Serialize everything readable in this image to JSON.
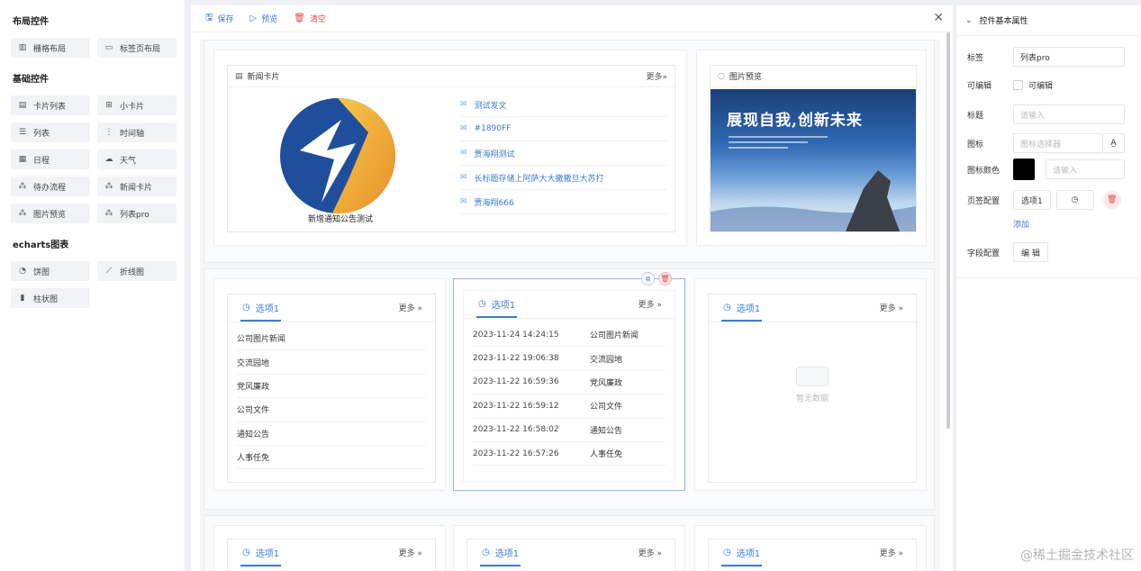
{
  "left": {
    "sections": [
      {
        "title": "布局控件",
        "items": [
          {
            "label": "栅格布局",
            "icon": "grid-icon"
          },
          {
            "label": "标签页布局",
            "icon": "folder-icon"
          }
        ]
      },
      {
        "title": "基础控件",
        "items": [
          {
            "label": "卡片列表",
            "icon": "card-list-icon"
          },
          {
            "label": "小卡片",
            "icon": "small-card-icon"
          },
          {
            "label": "列表",
            "icon": "list-icon"
          },
          {
            "label": "时间轴",
            "icon": "timeline-icon"
          },
          {
            "label": "日程",
            "icon": "calendar-icon"
          },
          {
            "label": "天气",
            "icon": "cloud-icon"
          },
          {
            "label": "待办流程",
            "icon": "flow-icon"
          },
          {
            "label": "新闻卡片",
            "icon": "flow-icon"
          },
          {
            "label": "图片预览",
            "icon": "flow-icon"
          },
          {
            "label": "列表pro",
            "icon": "flow-icon"
          }
        ]
      },
      {
        "title": "echarts图表",
        "items": [
          {
            "label": "饼图",
            "icon": "pie-icon"
          },
          {
            "label": "折线图",
            "icon": "line-chart-icon"
          },
          {
            "label": "柱状图",
            "icon": "bar-chart-icon"
          }
        ]
      }
    ]
  },
  "toolbar": {
    "save": "保存",
    "preview": "预览",
    "clear": "清空"
  },
  "news_card": {
    "title": "新闻卡片",
    "more": "更多»",
    "caption": "新增通知公告测试",
    "items": [
      "测试发文",
      "#1890FF",
      "贾海翔测试",
      "长标题存储上阿萨大大撒撒旦大苏打",
      "贾海翔666"
    ]
  },
  "photo_card": {
    "title": "图片预览",
    "photo_text": "展现自我,创新未来"
  },
  "tabs_row": [
    {
      "tab": "选项1",
      "more": "更多 »",
      "items": [
        {
          "text": "公司图片新闻"
        },
        {
          "text": "交流园地"
        },
        {
          "text": "党风廉政"
        },
        {
          "text": "公司文件"
        },
        {
          "text": "通知公告"
        },
        {
          "text": "人事任免"
        }
      ]
    },
    {
      "tab": "选项1",
      "more": "更多 »",
      "items": [
        {
          "date": "2023-11-24 14:24:15",
          "text": "公司图片新闻"
        },
        {
          "date": "2023-11-22 19:06:38",
          "text": "交流园地"
        },
        {
          "date": "2023-11-22 16:59:36",
          "text": "党风廉政"
        },
        {
          "date": "2023-11-22 16:59:12",
          "text": "公司文件"
        },
        {
          "date": "2023-11-22 16:58:02",
          "text": "通知公告"
        },
        {
          "date": "2023-11-22 16:57:26",
          "text": "人事任免"
        }
      ]
    },
    {
      "tab": "选项1",
      "more": "更多 »",
      "empty": "暂无数据"
    }
  ],
  "tabs_row2": [
    {
      "tab": "选项1",
      "more": "更多 »"
    },
    {
      "tab": "选项1",
      "more": "更多 »"
    },
    {
      "tab": "选项1",
      "more": "更多 »"
    }
  ],
  "right": {
    "header": "控件基本属性",
    "label_label": "标签",
    "label_value": "列表pro",
    "editable_label": "可编辑",
    "editable_check": "可编辑",
    "title_label": "标题",
    "title_placeholder": "请输入",
    "icon_label": "图标",
    "icon_placeholder": "图标选择器",
    "icon_color_label": "图标颜色",
    "icon_color_placeholder": "请输入",
    "icon_color": "#000000",
    "tab_config_label": "页签配置",
    "tab_config_value": "选项1",
    "add": "添加",
    "field_config_label": "字段配置",
    "field_config_btn": "编 辑"
  },
  "watermark": "@稀土掘金技术社区"
}
